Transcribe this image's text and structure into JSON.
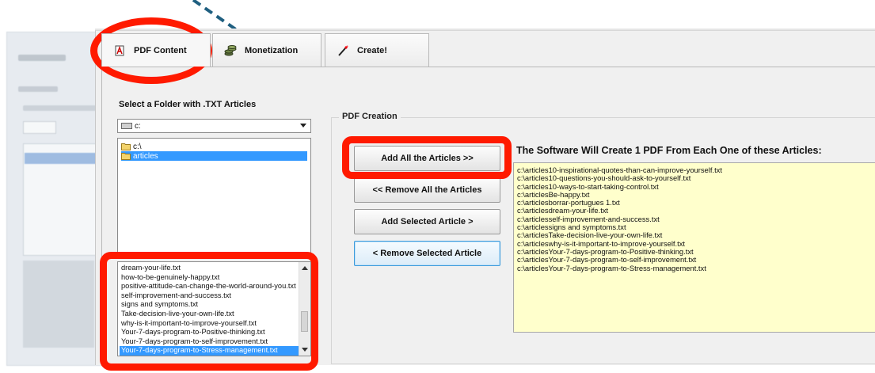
{
  "tabs": [
    {
      "label": "PDF Content",
      "icon": "pdf-icon"
    },
    {
      "label": "Monetization",
      "icon": "coins-icon"
    },
    {
      "label": "Create!",
      "icon": "magic-wand-icon"
    }
  ],
  "folder_section": {
    "label": "Select a Folder with .TXT Articles",
    "drive": "c:",
    "tree": [
      "c:\\",
      "articles"
    ]
  },
  "file_list": [
    "dream-your-life.txt",
    "how-to-be-genuinely-happy.txt",
    "positive-attitude-can-change-the-world-around-you.txt",
    "self-improvement-and-success.txt",
    "signs and symptoms.txt",
    "Take-decision-live-your-own-life.txt",
    "why-is-it-important-to-improve-yourself.txt",
    "Your-7-days-program-to-Positive-thinking.txt",
    "Your-7-days-program-to-self-improvement.txt",
    "Your-7-days-program-to-Stress-management.txt"
  ],
  "pdf_creation": {
    "title": "PDF Creation",
    "buttons": {
      "add_all": "Add All the Articles >>",
      "remove_all": "<< Remove All the Articles",
      "add_selected": "Add Selected Article >",
      "remove_selected": "< Remove Selected Article"
    },
    "result_label": "The Software Will Create 1 PDF From Each One of these Articles:",
    "result_items": [
      "c:\\articles10-inspirational-quotes-than-can-improve-yourself.txt",
      "c:\\articles10-questions-you-should-ask-to-yourself.txt",
      "c:\\articles10-ways-to-start-taking-control.txt",
      "c:\\articlesBe-happy.txt",
      "c:\\articlesborrar-portugues 1.txt",
      "c:\\articlesdream-your-life.txt",
      "c:\\articlesself-improvement-and-success.txt",
      "c:\\articlessigns and symptoms.txt",
      "c:\\articlesTake-decision-live-your-own-life.txt",
      "c:\\articleswhy-is-it-important-to-improve-yourself.txt",
      "c:\\articlesYour-7-days-program-to-Positive-thinking.txt",
      "c:\\articlesYour-7-days-program-to-self-improvement.txt",
      "c:\\articlesYour-7-days-program-to-Stress-management.txt"
    ]
  },
  "colors": {
    "highlight_red": "#ff1a00",
    "selection_blue": "#3399ff",
    "result_bg": "#ffffcc",
    "pointer_line": "#1f5f80"
  }
}
